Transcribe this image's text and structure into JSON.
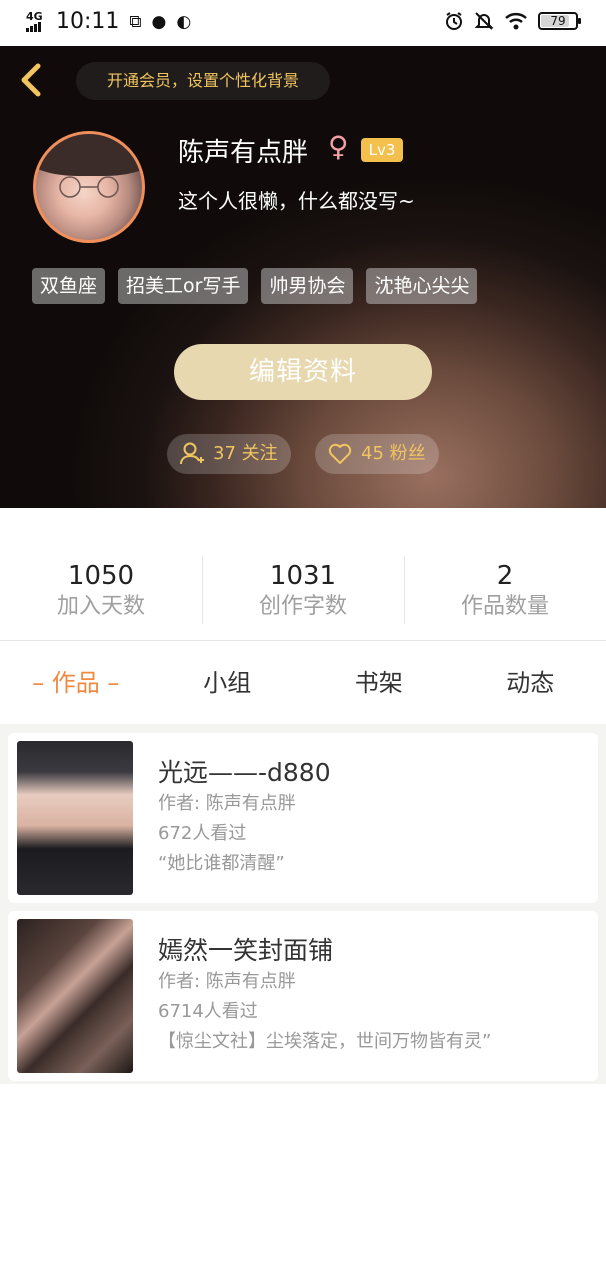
{
  "status_bar": {
    "network": "4G",
    "time": "10:11",
    "battery": "79",
    "battery_level": 0.79
  },
  "header": {
    "vip_prompt": "开通会员，设置个性化背景",
    "nickname": "陈声有点胖",
    "gender_symbol": "♀",
    "level": "Lv3",
    "signature": "这个人很懒，什么都没写~",
    "tags": [
      "双鱼座",
      "招美工or写手",
      "帅男协会",
      "沈艳心尖尖"
    ],
    "edit_button": "编辑资料",
    "following_label": "37 关注",
    "fans_label": "45 粉丝",
    "accent_color": "#f0c560"
  },
  "stats": [
    {
      "value": "1050",
      "label": "加入天数"
    },
    {
      "value": "1031",
      "label": "创作字数"
    },
    {
      "value": "2",
      "label": "作品数量"
    }
  ],
  "tabs": [
    "– 作品 –",
    "小组",
    "书架",
    "动态"
  ],
  "works": [
    {
      "title": "光远——-d880",
      "author": "作者: 陈声有点胖",
      "views": "672人看过",
      "quote": "“她比谁都清醒”"
    },
    {
      "title": "嫣然一笑封面铺",
      "author": "作者: 陈声有点胖",
      "views": "6714人看过",
      "quote": "【惊尘文社】尘埃落定，世间万物皆有灵”"
    }
  ]
}
